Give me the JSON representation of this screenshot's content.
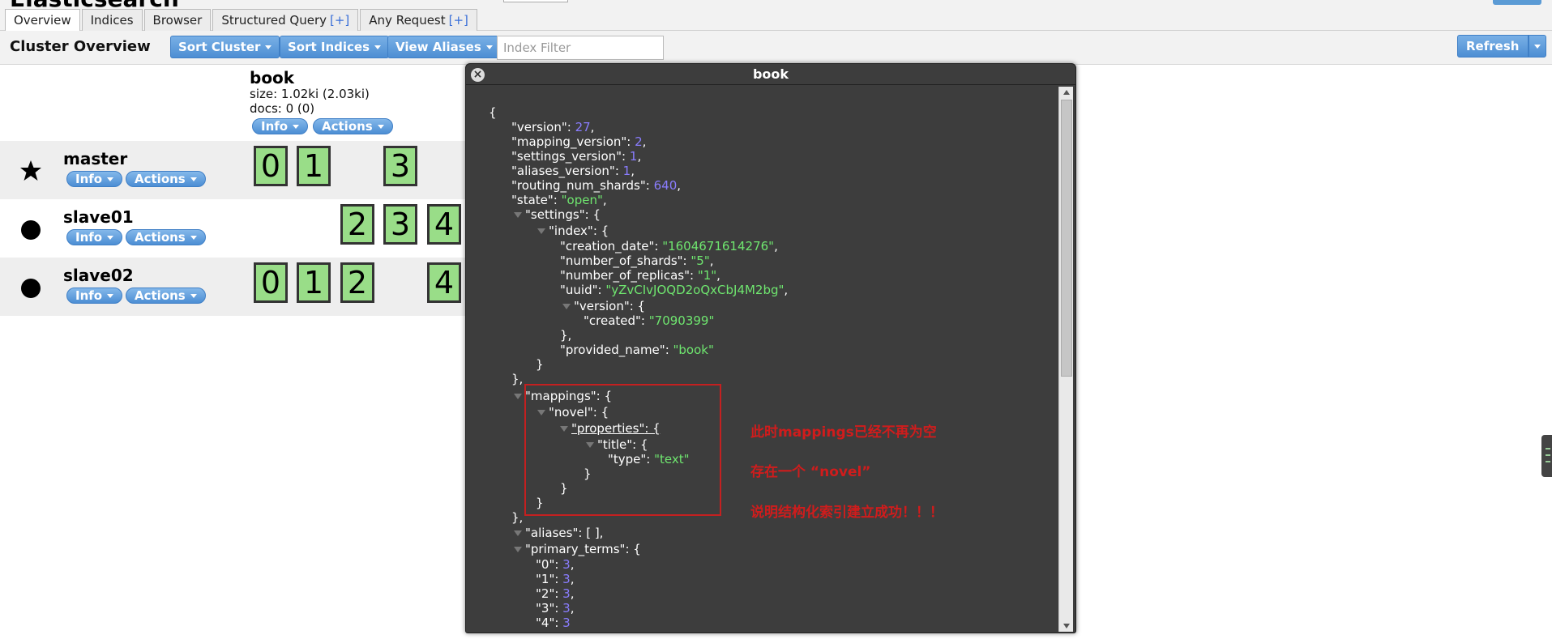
{
  "app": {
    "title": "Elasticsearch"
  },
  "tabs": [
    {
      "label": "Overview",
      "active": true
    },
    {
      "label": "Indices"
    },
    {
      "label": "Browser"
    },
    {
      "label": "Structured Query",
      "plus": "[+]"
    },
    {
      "label": "Any Request",
      "plus": "[+]"
    }
  ],
  "toolbar": {
    "title": "Cluster Overview",
    "sort_cluster": "Sort Cluster",
    "sort_indices": "Sort Indices",
    "view_aliases": "View Aliases",
    "filter_placeholder": "Index Filter",
    "refresh": "Refresh"
  },
  "index": {
    "name": "book",
    "size": "size: 1.02ki (2.03ki)",
    "docs": "docs: 0 (0)",
    "info": "Info",
    "actions": "Actions"
  },
  "nodes": [
    {
      "name": "master",
      "icon": "star-icon",
      "shards": [
        "0",
        "1",
        "",
        "3",
        ""
      ],
      "info": "Info",
      "actions": "Actions"
    },
    {
      "name": "slave01",
      "icon": "circle-icon",
      "shards": [
        "",
        "",
        "2",
        "3",
        "4"
      ],
      "info": "Info",
      "actions": "Actions"
    },
    {
      "name": "slave02",
      "icon": "circle-icon",
      "shards": [
        "0",
        "1",
        "2",
        "",
        "4"
      ],
      "info": "Info",
      "actions": "Actions"
    }
  ],
  "dialog": {
    "title": "book",
    "json_lines": [
      "{",
      "\"version\": 27,",
      "\"mapping_version\": 2,",
      "\"settings_version\": 1,",
      "\"aliases_version\": 1,",
      "\"routing_num_shards\": 640,",
      "\"state\": \"open\",",
      "\"settings\": {",
      "\"index\": {",
      "\"creation_date\": \"1604671614276\",",
      "\"number_of_shards\": \"5\",",
      "\"number_of_replicas\": \"1\",",
      "\"uuid\": \"yZvCIvJOQD2oQxCbJ4M2bg\",",
      "\"version\": {",
      "\"created\": \"7090399\"",
      "},",
      "\"provided_name\": \"book\"",
      "}",
      "},",
      "\"mappings\": {",
      "\"novel\": {",
      "\"properties\": {",
      "\"title\": {",
      "\"type\": \"text\"",
      "}",
      "}",
      "},",
      "\"aliases\": [ ],",
      "\"primary_terms\": {",
      "\"0\": 3,",
      "\"1\": 3,",
      "\"2\": 3,",
      "\"3\": 3,",
      "\"4\": 3"
    ]
  },
  "annotations": [
    "此时mappings已经不再为空",
    "存在一个 “novel”",
    "说明结构化索引建立成功！！！"
  ],
  "colors": {
    "accent": "#4d8ed3",
    "shard": "#99dd88",
    "annotation": "#d01c1c",
    "json_number": "#8a7dff",
    "json_string": "#6fe66f"
  }
}
